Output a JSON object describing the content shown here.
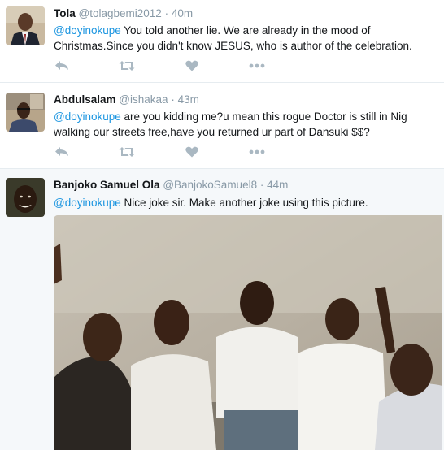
{
  "tweets": [
    {
      "name": "Tola",
      "handle": "@tolagbemi2012",
      "separator": "·",
      "time": "40m",
      "mention": "@doyinokupe",
      "body": " You told another lie. We are already in the mood of Christmas.Since you didn't know JESUS, who is author of the celebration."
    },
    {
      "name": "Abdulsalam",
      "handle": "@ishakaa",
      "separator": "·",
      "time": "43m",
      "mention": "@doyinokupe",
      "body": " are you kidding me?u mean this rogue Doctor is still in Nig walking our streets free,have you returned ur part of Dansuki $$?"
    },
    {
      "name": "Banjoko Samuel Ola",
      "handle": "@BanjokoSamuel8",
      "separator": "·",
      "time": "44m",
      "mention": "@doyinokupe",
      "body": " Nice joke sir. Make another joke using this picture."
    }
  ],
  "action_icons": [
    "reply-icon",
    "retweet-icon",
    "like-icon",
    "more-icon"
  ],
  "colors": {
    "link": "#1b95e0",
    "meta": "#8899a6",
    "icon": "#aab8c2",
    "highlight_bg": "#f5f8fa"
  }
}
